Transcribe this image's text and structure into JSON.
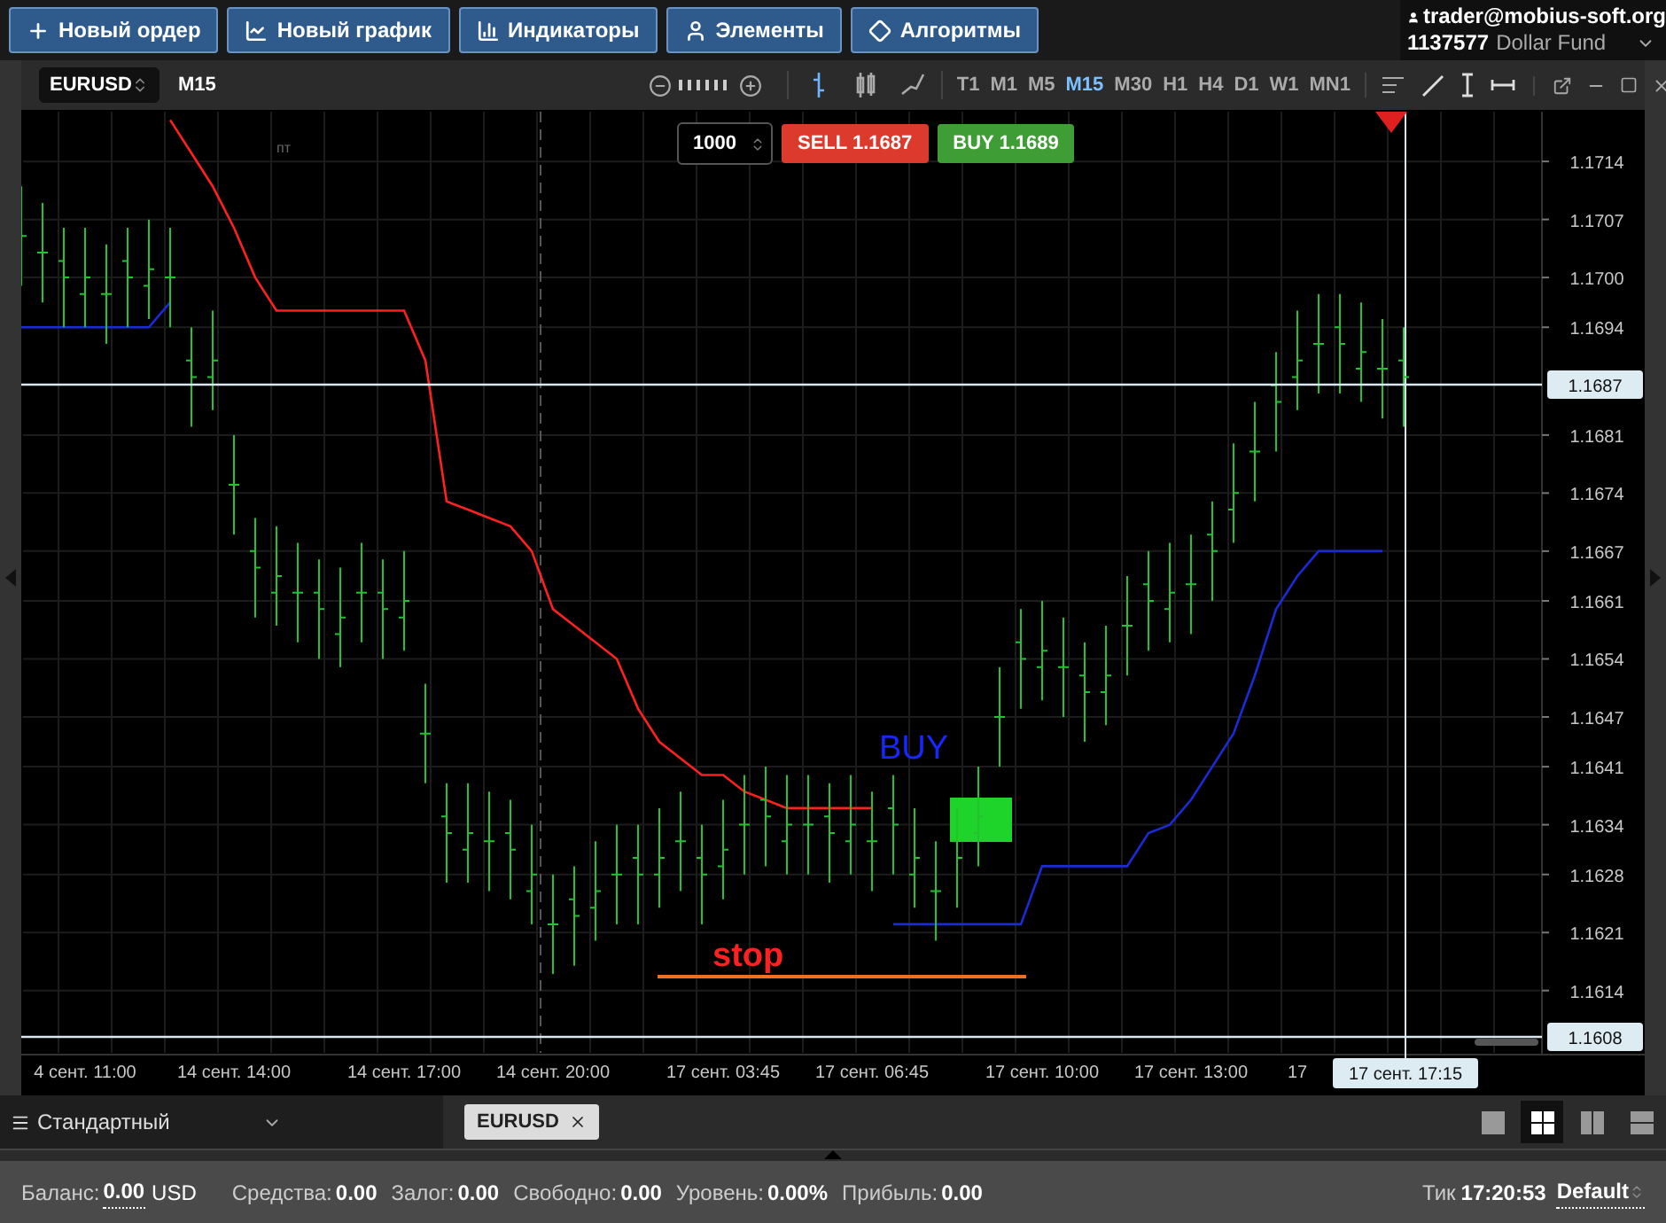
{
  "toolbar": {
    "buttons": [
      {
        "label": "Новый ордер"
      },
      {
        "label": "Новый график"
      },
      {
        "label": "Индикаторы"
      },
      {
        "label": "Элементы"
      },
      {
        "label": "Алгоритмы"
      }
    ]
  },
  "account": {
    "user": "trader@mobius-soft.org",
    "number": "1137577",
    "fund": "Dollar Fund"
  },
  "chart_window": {
    "symbol": "EURUSD",
    "period": "M15",
    "chart_types": [
      {
        "selected": true
      },
      {
        "selected": false
      },
      {
        "selected": false
      }
    ],
    "timeframes": [
      {
        "label": "T1",
        "selected": false
      },
      {
        "label": "M1",
        "selected": false
      },
      {
        "label": "M5",
        "selected": false
      },
      {
        "label": "M15",
        "selected": true
      },
      {
        "label": "M30",
        "selected": false
      },
      {
        "label": "H1",
        "selected": false
      },
      {
        "label": "H4",
        "selected": false
      },
      {
        "label": "D1",
        "selected": false
      },
      {
        "label": "W1",
        "selected": false
      },
      {
        "label": "MN1",
        "selected": false
      }
    ],
    "order_panel": {
      "volume": "1000",
      "sell_label": "SELL",
      "sell_price": "1.1687",
      "buy_label": "BUY",
      "buy_price": "1.1689"
    },
    "session_label": "пт",
    "current_price": "1.1687",
    "bottom_price": "1.1608",
    "crosshair_time": "17 сент. 17:15",
    "chart_data": {
      "type": "line",
      "grid": true,
      "ylim": [
        1.1602,
        1.172
      ],
      "categories": [
        null,
        null,
        null,
        "4 сент. 11:00",
        null,
        null,
        null,
        null,
        null,
        null,
        "14 сент. 14:00",
        null,
        null,
        null,
        null,
        null,
        null,
        null,
        "14 сент. 17:00",
        null,
        null,
        null,
        null,
        null,
        null,
        "14 сент. 20:00",
        null,
        null,
        null,
        null,
        null,
        null,
        null,
        "17 сент. 03:45",
        null,
        null,
        null,
        null,
        null,
        null,
        "17 сент. 06:45",
        null,
        null,
        null,
        null,
        null,
        null,
        null,
        "17 сент. 10:00",
        null,
        null,
        null,
        null,
        null,
        null,
        "17 сент. 13:00",
        null,
        null,
        null,
        null,
        "17",
        null,
        null,
        null,
        null,
        null,
        null,
        null,
        null,
        null,
        null,
        null
      ],
      "yticks": [
        {
          "value": 1.1714,
          "label": "1.1714"
        },
        {
          "value": 1.1707,
          "label": "1.1707"
        },
        {
          "value": 1.17,
          "label": "1.1700"
        },
        {
          "value": 1.1694,
          "label": "1.1694"
        },
        {
          "value": 1.1681,
          "label": "1.1681"
        },
        {
          "value": 1.1674,
          "label": "1.1674"
        },
        {
          "value": 1.1667,
          "label": "1.1667"
        },
        {
          "value": 1.1661,
          "label": "1.1661"
        },
        {
          "value": 1.1654,
          "label": "1.1654"
        },
        {
          "value": 1.1647,
          "label": "1.1647"
        },
        {
          "value": 1.1641,
          "label": "1.1641"
        },
        {
          "value": 1.1634,
          "label": "1.1634"
        },
        {
          "value": 1.1628,
          "label": "1.1628"
        },
        {
          "value": 1.1621,
          "label": "1.1621"
        },
        {
          "value": 1.1614,
          "label": "1.1614"
        }
      ],
      "series": [
        {
          "color": "#ff2020",
          "values": [
            null,
            null,
            null,
            null,
            null,
            null,
            null,
            1.1719,
            1.1715,
            1.1711,
            1.1706,
            1.17,
            1.1696,
            1.1696,
            1.1696,
            1.1696,
            1.1696,
            1.1696,
            1.1696,
            1.169,
            1.1673,
            1.1672,
            1.1671,
            1.167,
            1.1667,
            1.166,
            1.1658,
            1.1656,
            1.1654,
            1.1648,
            1.1644,
            1.1642,
            1.164,
            1.164,
            1.1638,
            1.1637,
            1.1636,
            1.1636,
            1.1636,
            1.1636,
            1.1636,
            null,
            null,
            null,
            null,
            null,
            null,
            null,
            null,
            null,
            null,
            null,
            null,
            null,
            null,
            null,
            null,
            null,
            null,
            null,
            null,
            null,
            null,
            null,
            null,
            null,
            null,
            null,
            null,
            null,
            null,
            null
          ]
        },
        {
          "color": "#1a2bd8",
          "values": [
            1.1694,
            1.1694,
            1.1694,
            1.1694,
            1.1694,
            1.1694,
            1.1694,
            1.1697,
            null,
            null,
            null,
            null,
            null,
            null,
            null,
            null,
            null,
            null,
            null,
            null,
            null,
            null,
            null,
            null,
            null,
            null,
            null,
            null,
            null,
            null,
            null,
            null,
            null,
            null,
            null,
            null,
            null,
            null,
            null,
            null,
            null,
            1.1622,
            1.1622,
            1.1622,
            1.1622,
            1.1622,
            1.1622,
            1.1622,
            1.1629,
            1.1629,
            1.1629,
            1.1629,
            1.1629,
            1.1633,
            1.1634,
            1.1637,
            1.1641,
            1.1645,
            1.1652,
            1.166,
            1.1664,
            1.1667,
            1.1667,
            1.1667,
            1.1667,
            null,
            null,
            null,
            null,
            null,
            null,
            null
          ]
        }
      ],
      "annotations": [
        {
          "text": "BUY"
        },
        {
          "text": "stop"
        }
      ]
    }
  },
  "bottom_bar": {
    "layout": "Стандартный",
    "tabs": [
      {
        "label": "EURUSD",
        "selected": true
      }
    ],
    "layout_buttons": [
      {
        "selected": false
      },
      {
        "selected": true
      },
      {
        "selected": false
      },
      {
        "selected": false
      }
    ]
  },
  "status_bar": {
    "items": [
      {
        "label": "Баланс:",
        "value": "0.00",
        "unit": "USD"
      },
      {
        "label": "Средства:",
        "value": "0.00"
      },
      {
        "label": "Залог:",
        "value": "0.00"
      },
      {
        "label": "Свободно:",
        "value": "0.00"
      },
      {
        "label": "Уровень:",
        "value": "0.00%"
      },
      {
        "label": "Прибыль:",
        "value": "0.00"
      }
    ],
    "tick_label": "Тик",
    "tick_time": "17:20:53",
    "profile": "Default"
  }
}
